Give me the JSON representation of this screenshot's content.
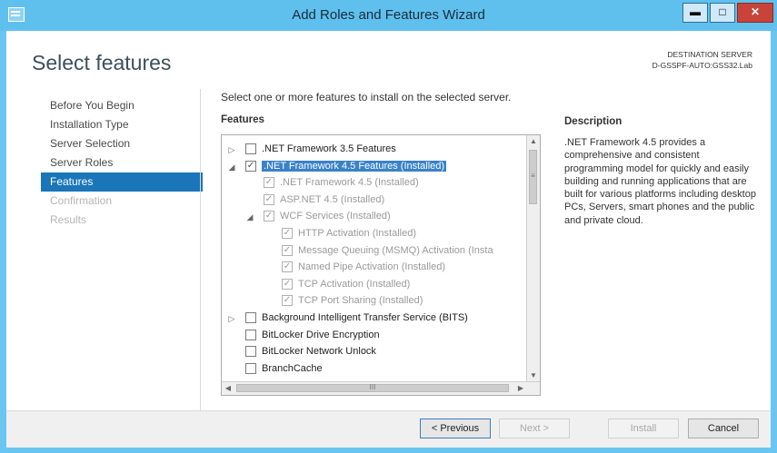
{
  "window": {
    "title": "Add Roles and Features Wizard",
    "min_glyph": "▬",
    "max_glyph": "□",
    "close_glyph": "✕"
  },
  "header": {
    "page_title": "Select features",
    "destination_label": "DESTINATION SERVER",
    "destination_server": "D-GSSPF-AUTO:GSS32.Lab"
  },
  "nav": {
    "items": [
      {
        "label": "Before You Begin",
        "state": "normal"
      },
      {
        "label": "Installation Type",
        "state": "normal"
      },
      {
        "label": "Server Selection",
        "state": "normal"
      },
      {
        "label": "Server Roles",
        "state": "normal"
      },
      {
        "label": "Features",
        "state": "active"
      },
      {
        "label": "Confirmation",
        "state": "disabled"
      },
      {
        "label": "Results",
        "state": "disabled"
      }
    ]
  },
  "main": {
    "instruction": "Select one or more features to install on the selected server.",
    "features_label": "Features",
    "description_label": "Description",
    "description_text": ".NET Framework 4.5 provides a comprehensive and consistent programming model for quickly and easily building and running applications that are built for various platforms including desktop PCs, Servers, smart phones and the public and private cloud."
  },
  "features": [
    {
      "label": ".NET Framework 3.5 Features",
      "level": 0,
      "expander": "collapsed",
      "checked": false,
      "dim": false,
      "selected": false
    },
    {
      "label": ".NET Framework 4.5 Features (Installed)",
      "level": 0,
      "expander": "expanded",
      "checked": true,
      "dim": false,
      "selected": true
    },
    {
      "label": ".NET Framework 4.5 (Installed)",
      "level": 1,
      "expander": "none",
      "checked": true,
      "dim": true,
      "selected": false
    },
    {
      "label": "ASP.NET 4.5 (Installed)",
      "level": 1,
      "expander": "none",
      "checked": true,
      "dim": true,
      "selected": false
    },
    {
      "label": "WCF Services (Installed)",
      "level": 1,
      "expander": "expanded",
      "checked": true,
      "dim": true,
      "selected": false
    },
    {
      "label": "HTTP Activation (Installed)",
      "level": 2,
      "expander": "none",
      "checked": true,
      "dim": true,
      "selected": false
    },
    {
      "label": "Message Queuing (MSMQ) Activation (Insta",
      "level": 2,
      "expander": "none",
      "checked": true,
      "dim": true,
      "selected": false
    },
    {
      "label": "Named Pipe Activation (Installed)",
      "level": 2,
      "expander": "none",
      "checked": true,
      "dim": true,
      "selected": false
    },
    {
      "label": "TCP Activation (Installed)",
      "level": 2,
      "expander": "none",
      "checked": true,
      "dim": true,
      "selected": false
    },
    {
      "label": "TCP Port Sharing (Installed)",
      "level": 2,
      "expander": "none",
      "checked": true,
      "dim": true,
      "selected": false
    },
    {
      "label": "Background Intelligent Transfer Service (BITS)",
      "level": 0,
      "expander": "collapsed",
      "checked": false,
      "dim": false,
      "selected": false
    },
    {
      "label": "BitLocker Drive Encryption",
      "level": 0,
      "expander": "none",
      "checked": false,
      "dim": false,
      "selected": false
    },
    {
      "label": "BitLocker Network Unlock",
      "level": 0,
      "expander": "none",
      "checked": false,
      "dim": false,
      "selected": false
    },
    {
      "label": "BranchCache",
      "level": 0,
      "expander": "none",
      "checked": false,
      "dim": false,
      "selected": false
    }
  ],
  "scrollbars": {
    "up": "▲",
    "down": "▼",
    "left": "◀",
    "right": "▶",
    "vgrip": "≡",
    "hgrip": "III"
  },
  "footer": {
    "previous": "< Previous",
    "next": "Next >",
    "install": "Install",
    "cancel": "Cancel"
  },
  "colors": {
    "titlebar": "#5fc0ee",
    "nav_active": "#1a75b9",
    "selection": "#3a82c8",
    "close_button": "#c8443a"
  }
}
